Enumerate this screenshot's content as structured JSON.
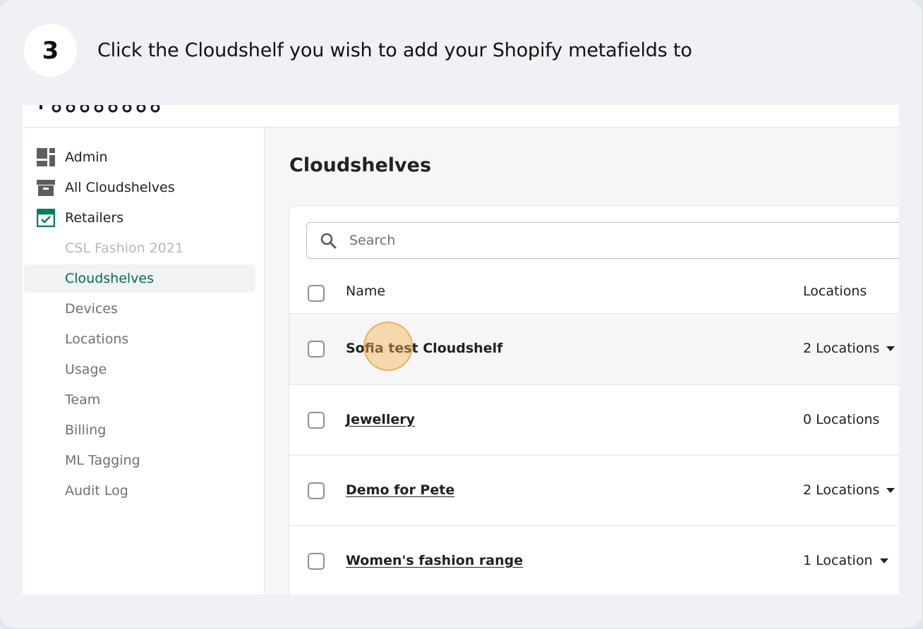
{
  "step": {
    "number": "3",
    "instruction": "Click the Cloudshelf you wish to add your Shopify metafields to"
  },
  "sidebar": {
    "items": [
      {
        "label": "Admin",
        "icon": "admin-dashboard-icon"
      },
      {
        "label": "All Cloudshelves",
        "icon": "box-icon"
      },
      {
        "label": "Retailers",
        "icon": "store-icon"
      }
    ],
    "sub_items": [
      {
        "label": "CSL Fashion 2021"
      },
      {
        "label": "Cloudshelves"
      },
      {
        "label": "Devices"
      },
      {
        "label": "Locations"
      },
      {
        "label": "Usage"
      },
      {
        "label": "Team"
      },
      {
        "label": "Billing"
      },
      {
        "label": "ML Tagging"
      },
      {
        "label": "Audit Log"
      }
    ]
  },
  "main": {
    "title": "Cloudshelves",
    "search": {
      "placeholder": "Search",
      "value": ""
    },
    "table": {
      "columns": [
        "Name",
        "Locations"
      ],
      "rows": [
        {
          "name": "Sofia test Cloudshelf",
          "locations": "2 Locations"
        },
        {
          "name": "Jewellery",
          "locations": "0 Locations"
        },
        {
          "name": "Demo for Pete",
          "locations": "2 Locations"
        },
        {
          "name": "Women's fashion range",
          "locations": "1 Location"
        }
      ]
    }
  },
  "colors": {
    "accent_green": "#006e52",
    "click_highlight": "#f5b450",
    "background": "#f0f1f5"
  }
}
